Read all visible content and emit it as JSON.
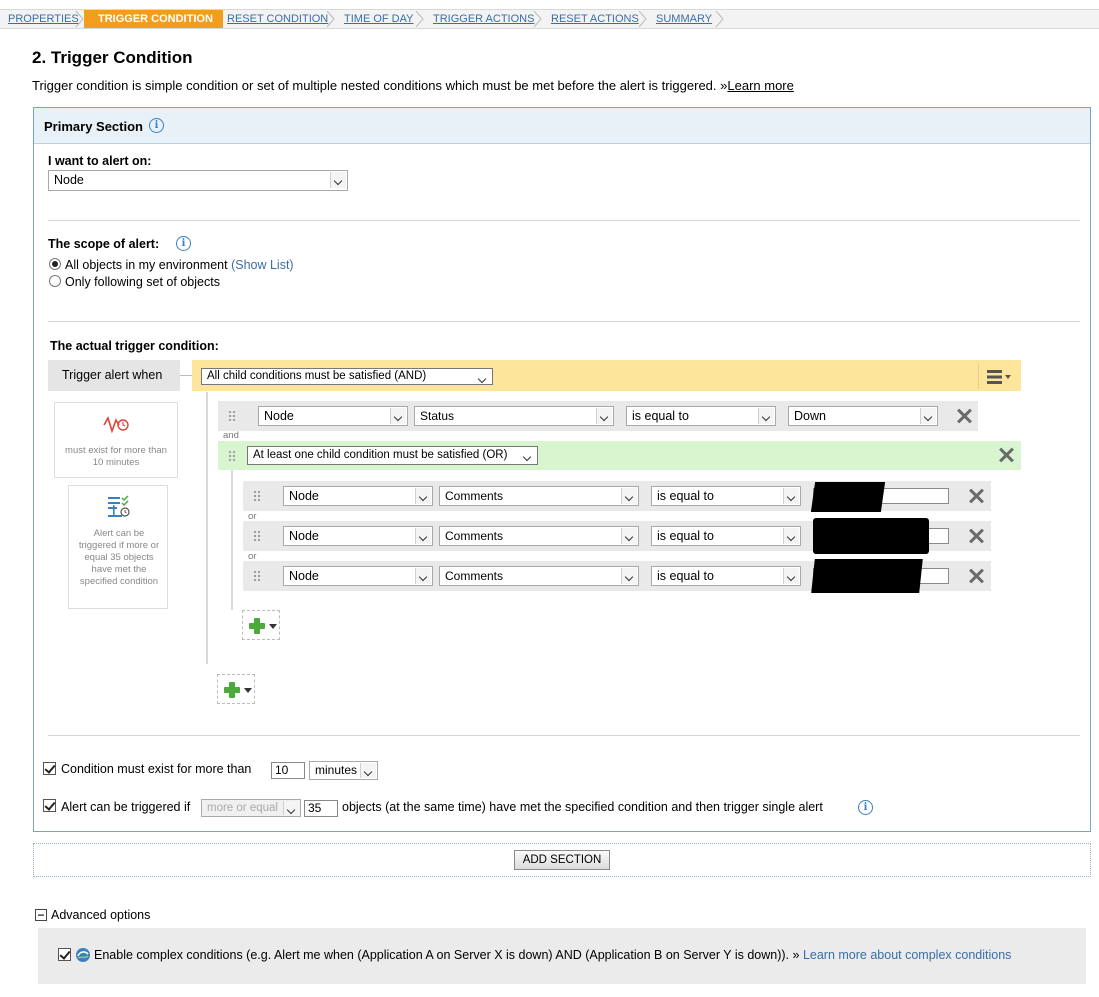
{
  "wizard": {
    "steps": [
      "PROPERTIES",
      "TRIGGER CONDITION",
      "RESET CONDITION",
      "TIME OF DAY",
      "TRIGGER ACTIONS",
      "RESET ACTIONS",
      "SUMMARY"
    ],
    "active": "TRIGGER CONDITION"
  },
  "page": {
    "title": "2. Trigger Condition",
    "intro": "Trigger condition is simple condition or set of multiple nested conditions which must be met before the alert is triggered.",
    "intro_link_prefix": "»",
    "intro_link": "Learn more"
  },
  "primary": {
    "title": "Primary Section",
    "alert_on_label": "I want to alert on:",
    "alert_on_value": "Node",
    "scope_label": "The scope of alert:",
    "scope_all": "All objects in my environment",
    "scope_all_link": "(Show List)",
    "scope_only": "Only following set of objects",
    "scope_selected": "all",
    "trigger_label": "The actual trigger condition:",
    "trigger_when": "Trigger alert when",
    "and_group": "All child conditions must be satisfied (AND)",
    "cond1": {
      "obj": "Node",
      "field": "Status",
      "op": "is equal to",
      "value": "Down"
    },
    "and_word": "and",
    "or_group": "At least one child condition must be satisfied (OR)",
    "or_word": "or",
    "or_conditions": [
      {
        "obj": "Node",
        "field": "Comments",
        "op": "is equal to"
      },
      {
        "obj": "Node",
        "field": "Comments",
        "op": "is equal to"
      },
      {
        "obj": "Node",
        "field": "Comments",
        "op": "is equal to"
      }
    ],
    "side_card1": "must exist for more than 10 minutes",
    "side_card2": "Alert can be triggered if more or equal 35 objects have met the specified condition",
    "exist_label": "Condition must exist for more than",
    "exist_value": "10",
    "exist_unit": "minutes",
    "exist_checked": true,
    "trig_label_pre": "Alert can be triggered if",
    "trig_compare": "more or equal",
    "trig_count": "35",
    "trig_label_post": "objects (at the same time) have met the specified condition and then trigger single alert",
    "trig_checked": true
  },
  "add_section": "ADD SECTION",
  "advanced": {
    "label": "Advanced options",
    "complex_text": "Enable complex conditions (e.g. Alert me when (Application A on Server X is down) AND (Application B on Server Y is down)).",
    "complex_link_prefix": "»",
    "complex_link": "Learn more about complex conditions",
    "complex_checked": true
  }
}
